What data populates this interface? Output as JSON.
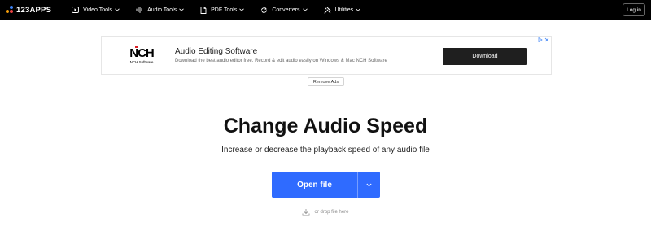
{
  "brand": {
    "name": "123APPS"
  },
  "nav": {
    "items": [
      {
        "label": "Video Tools",
        "icon": "video-icon"
      },
      {
        "label": "Audio Tools",
        "icon": "audio-wave-icon"
      },
      {
        "label": "PDF Tools",
        "icon": "pdf-icon"
      },
      {
        "label": "Converters",
        "icon": "convert-icon"
      },
      {
        "label": "Utilities",
        "icon": "tools-icon"
      }
    ],
    "login_label": "Log in"
  },
  "ad": {
    "logo_text": "NCH",
    "logo_sub": "NCH Software",
    "title": "Audio Editing Software",
    "description": "Download the best audio editor free. Record & edit audio easily on Windows & Mac NCH Software",
    "button_label": "Download",
    "remove_label": "Remove Ads"
  },
  "main": {
    "title": "Change Audio Speed",
    "subtitle": "Increase or decrease the playback speed of any audio file",
    "open_label": "Open file",
    "drop_hint": "or drop file here"
  },
  "colors": {
    "topbar": "#000000",
    "accent": "#2f6bff",
    "ad_button": "#1f1f1f"
  }
}
